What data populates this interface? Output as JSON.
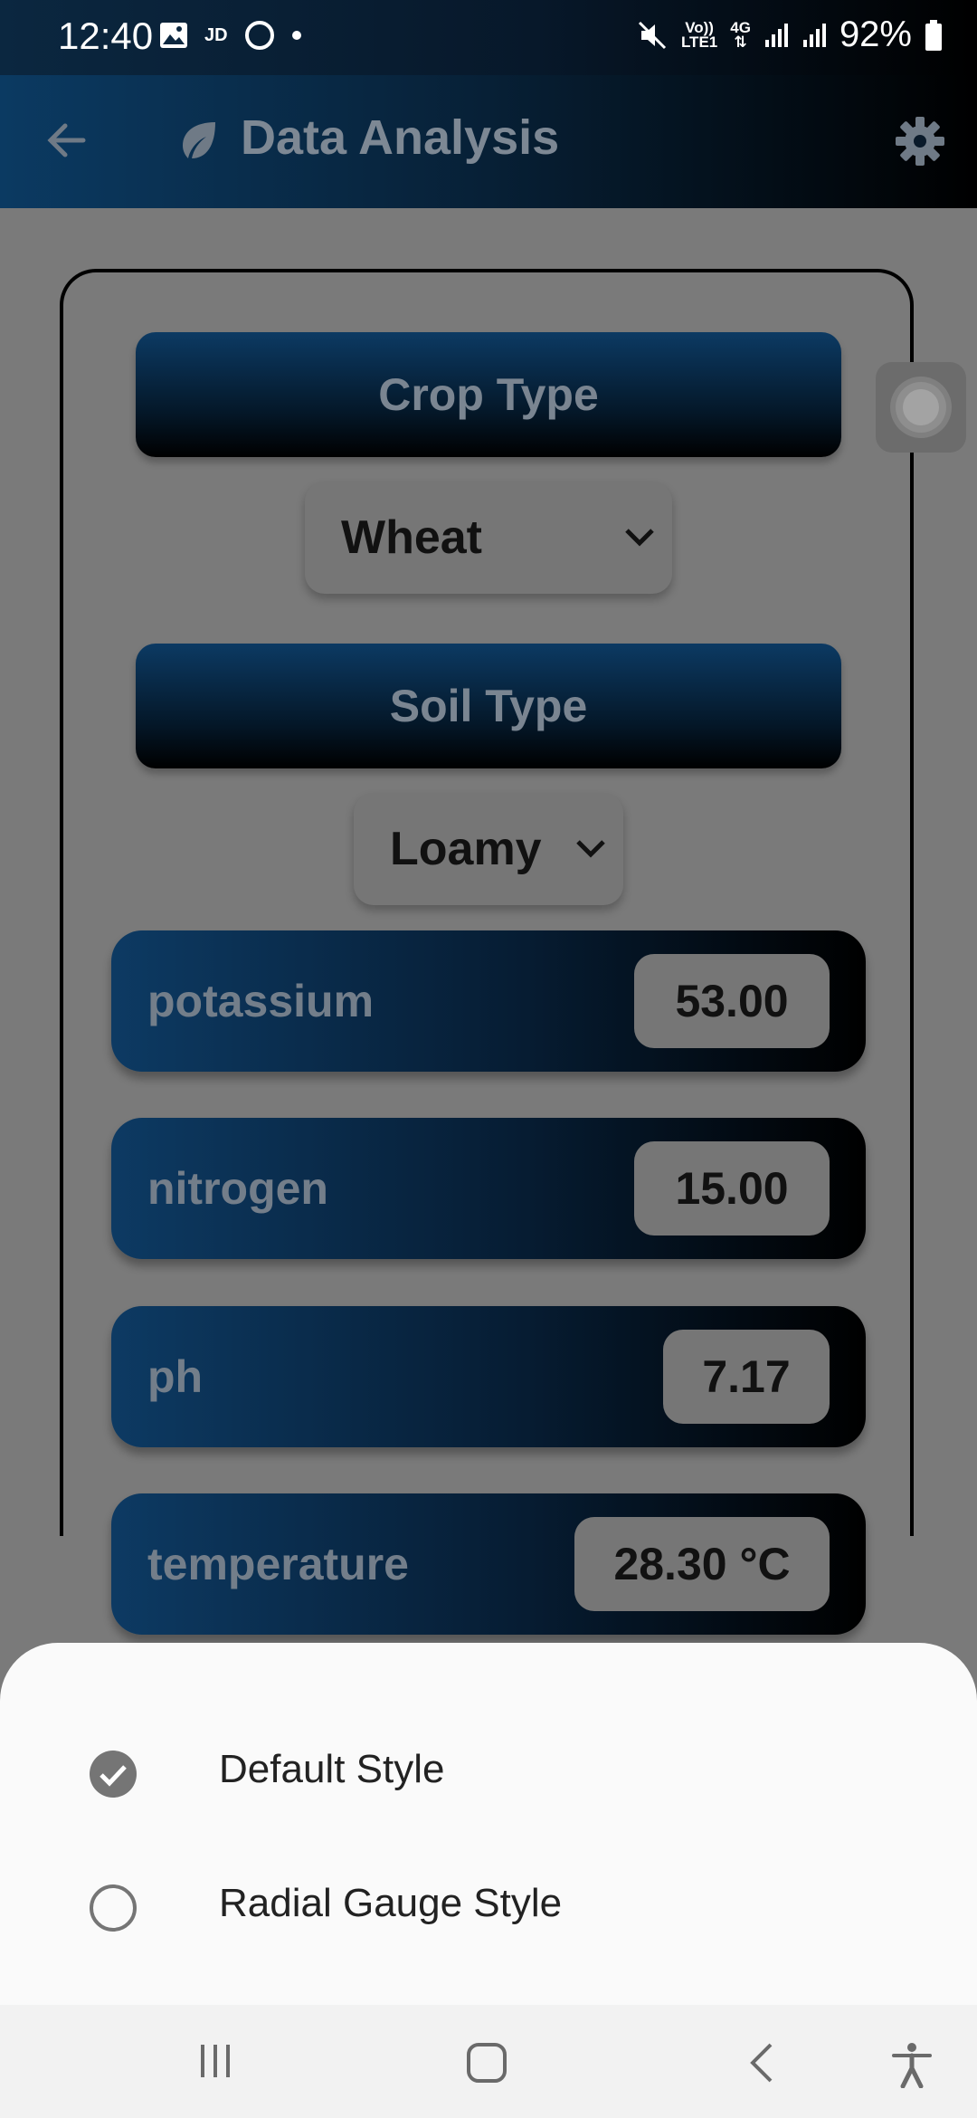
{
  "status_bar": {
    "time": "12:40",
    "carrier_badge": "JD",
    "volte_top": "Vo))",
    "volte_bottom": "LTE1",
    "network": "4G",
    "battery_percent": "92%"
  },
  "app_bar": {
    "title": "Data Analysis",
    "icons": [
      "back-arrow-icon",
      "leaf-icon",
      "gear-icon"
    ]
  },
  "form": {
    "crop_type_label": "Crop Type",
    "crop_type_value": "Wheat",
    "soil_type_label": "Soil Type",
    "soil_type_value": "Loamy"
  },
  "readings": [
    {
      "label": "potassium",
      "value": "53.00"
    },
    {
      "label": "nitrogen",
      "value": "15.00"
    },
    {
      "label": "ph",
      "value": "7.17"
    },
    {
      "label": "temperature",
      "value": "28.30 °C"
    }
  ],
  "style_sheet": {
    "options": [
      {
        "label": "Default Style",
        "selected": true
      },
      {
        "label": "Radial Gauge Style",
        "selected": false
      }
    ]
  },
  "colors": {
    "accent_blue": "#0c3a63",
    "dark": "#000000",
    "sheet_bg": "#fafafa",
    "scrim_gray": "#7a7a7a"
  }
}
